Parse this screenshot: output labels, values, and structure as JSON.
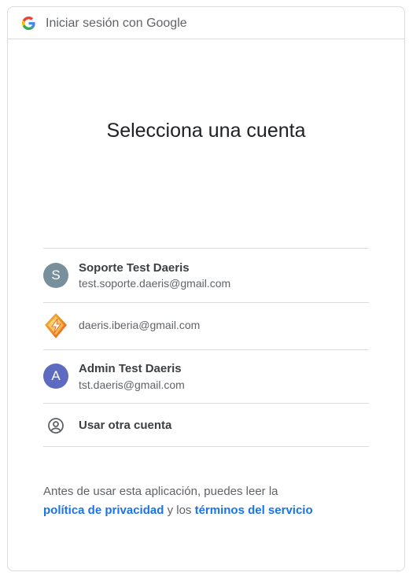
{
  "header": {
    "title": "Iniciar sesión con Google",
    "logo_icon": "google-g-icon"
  },
  "main": {
    "title": "Selecciona una cuenta"
  },
  "accounts": [
    {
      "name": "Soporte Test Daeris",
      "email": "test.soporte.daeris@gmail.com",
      "avatar_letter": "S",
      "avatar_color": "#78909c"
    },
    {
      "email": "daeris.iberia@gmail.com",
      "avatar_icon": "app-bolt-logo-icon"
    },
    {
      "name": "Admin Test Daeris",
      "email": "tst.daeris@gmail.com",
      "avatar_letter": "A",
      "avatar_color": "#5c6bc0"
    }
  ],
  "other_account": {
    "label": "Usar otra cuenta",
    "icon": "account-circle-icon"
  },
  "footer": {
    "text_before": "Antes de usar esta aplicación, puedes leer la",
    "privacy_link": "política de privacidad",
    "connector": "y los",
    "terms_link": "términos del servicio"
  },
  "colors": {
    "link": "#1a73e8",
    "divider": "#dadce0"
  }
}
